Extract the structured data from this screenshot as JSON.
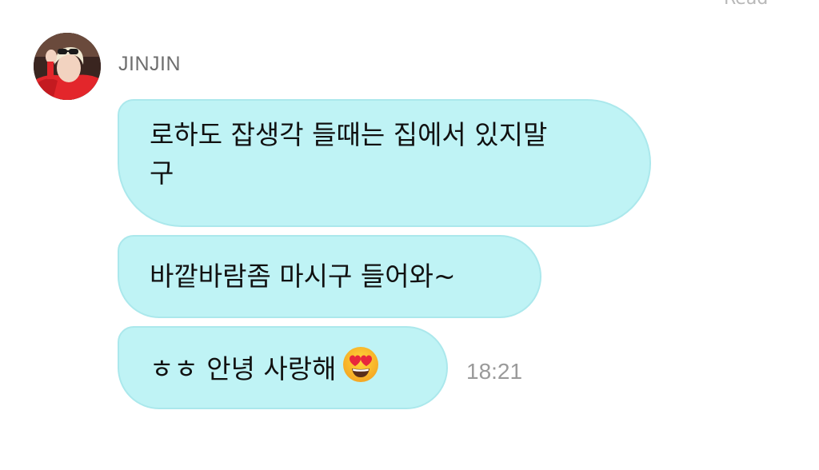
{
  "header": {
    "read_label": "Read"
  },
  "chat": {
    "sender_name": "JINJIN",
    "avatar_icon": "profile-photo-avatar",
    "bubble_color": "#bff3f5",
    "messages": [
      {
        "line1": "로하도 잡생각 들때는 집에서 있지말",
        "line2": "구"
      },
      {
        "text": "바깥바람좀 마시구 들어와~"
      },
      {
        "text": "ㅎㅎ 안녕 사랑해",
        "emoji": "heart-eyes-emoji"
      }
    ],
    "timestamp": "18:21"
  }
}
